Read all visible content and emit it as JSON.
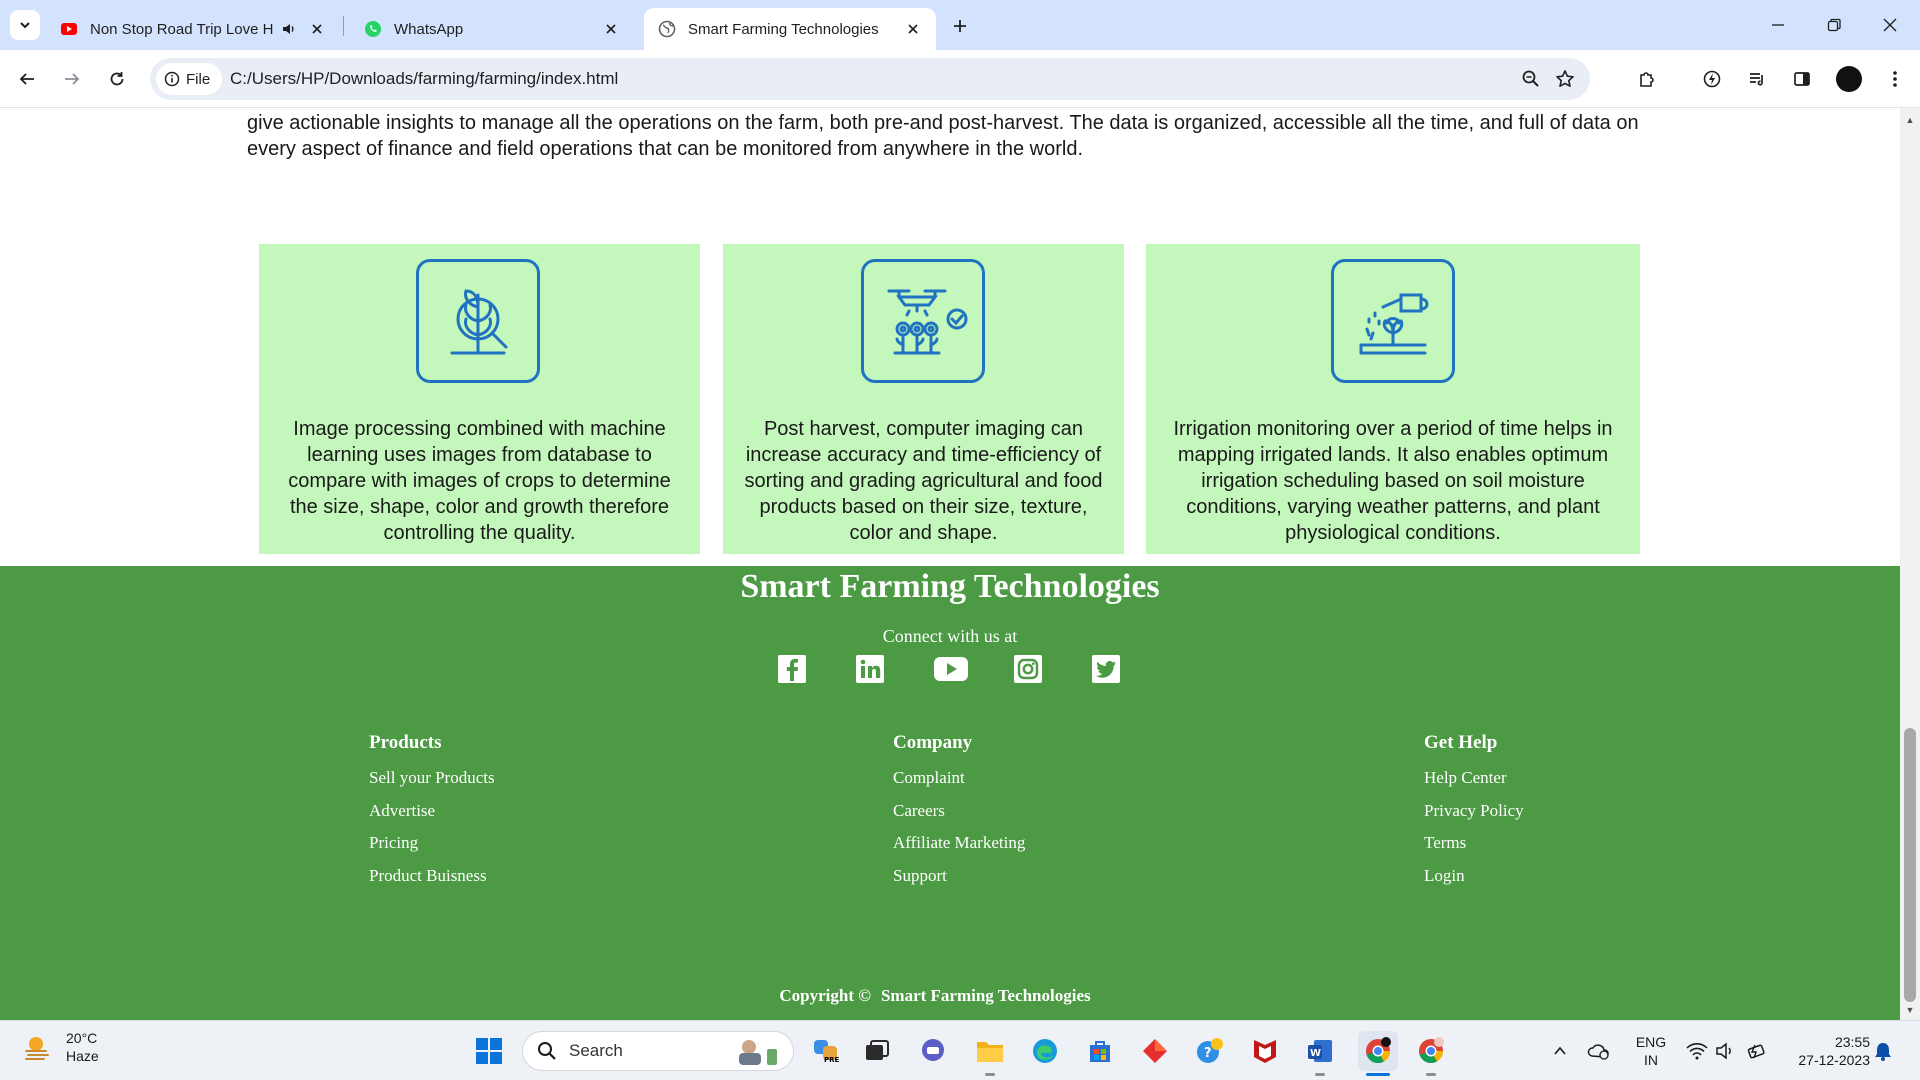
{
  "browser": {
    "tabs": [
      {
        "title": "Non Stop Road Trip Love Hi",
        "favicon": "youtube-icon",
        "active": false
      },
      {
        "title": "WhatsApp",
        "favicon": "whatsapp-icon",
        "active": false
      },
      {
        "title": "Smart Farming Technologies",
        "favicon": "globe-icon",
        "active": true
      }
    ],
    "chip_label": "File",
    "url": "C:/Users/HP/Downloads/farming/farming/index.html"
  },
  "page": {
    "intro": "give actionable insights to manage all the operations on the farm, both pre-and post-harvest. The data is organized, accessible all the time, and full of data on every aspect of finance and field operations that can be monitored from anywhere in the world.",
    "cards": [
      {
        "icon": "plant-magnifier-icon",
        "text": "Image processing combined with machine learning uses images from database to compare with images of crops to determine the size, shape, color and growth therefore controlling the quality."
      },
      {
        "icon": "drone-crops-icon",
        "text": "Post harvest, computer imaging can increase accuracy and time-efficiency of sorting and grading agricultural and food products based on their size, texture, color and shape."
      },
      {
        "icon": "watering-can-icon",
        "text": "Irrigation monitoring over a period of time helps in mapping irrigated lands. It also enables optimum irrigation scheduling based on soil moisture conditions, varying weather patterns, and plant physiological conditions."
      }
    ],
    "card_bg": "#c4f7bb",
    "icon_color": "#1f73c1"
  },
  "footer": {
    "bg": "#4c9a43",
    "brand": "Smart Farming Technologies",
    "connect": "Connect with us at",
    "social": [
      "facebook-icon",
      "linkedin-icon",
      "youtube-icon",
      "instagram-icon",
      "twitter-icon"
    ],
    "columns": [
      {
        "head": "Products",
        "links": [
          "Sell your Products",
          "Advertise",
          "Pricing",
          "Product Buisness"
        ]
      },
      {
        "head": "Company",
        "links": [
          "Complaint",
          "Careers",
          "Affiliate Marketing",
          "Support"
        ]
      },
      {
        "head": "Get Help",
        "links": [
          "Help Center",
          "Privacy Policy",
          "Terms",
          "Login"
        ]
      }
    ],
    "copyright_label": "Copyright ©",
    "copyright_name": "Smart Farming Technologies"
  },
  "taskbar": {
    "temperature": "20°C",
    "weather": "Haze",
    "search": "Search",
    "lang_top": "ENG",
    "lang_bottom": "IN",
    "time": "23:55",
    "date": "27-12-2023"
  }
}
